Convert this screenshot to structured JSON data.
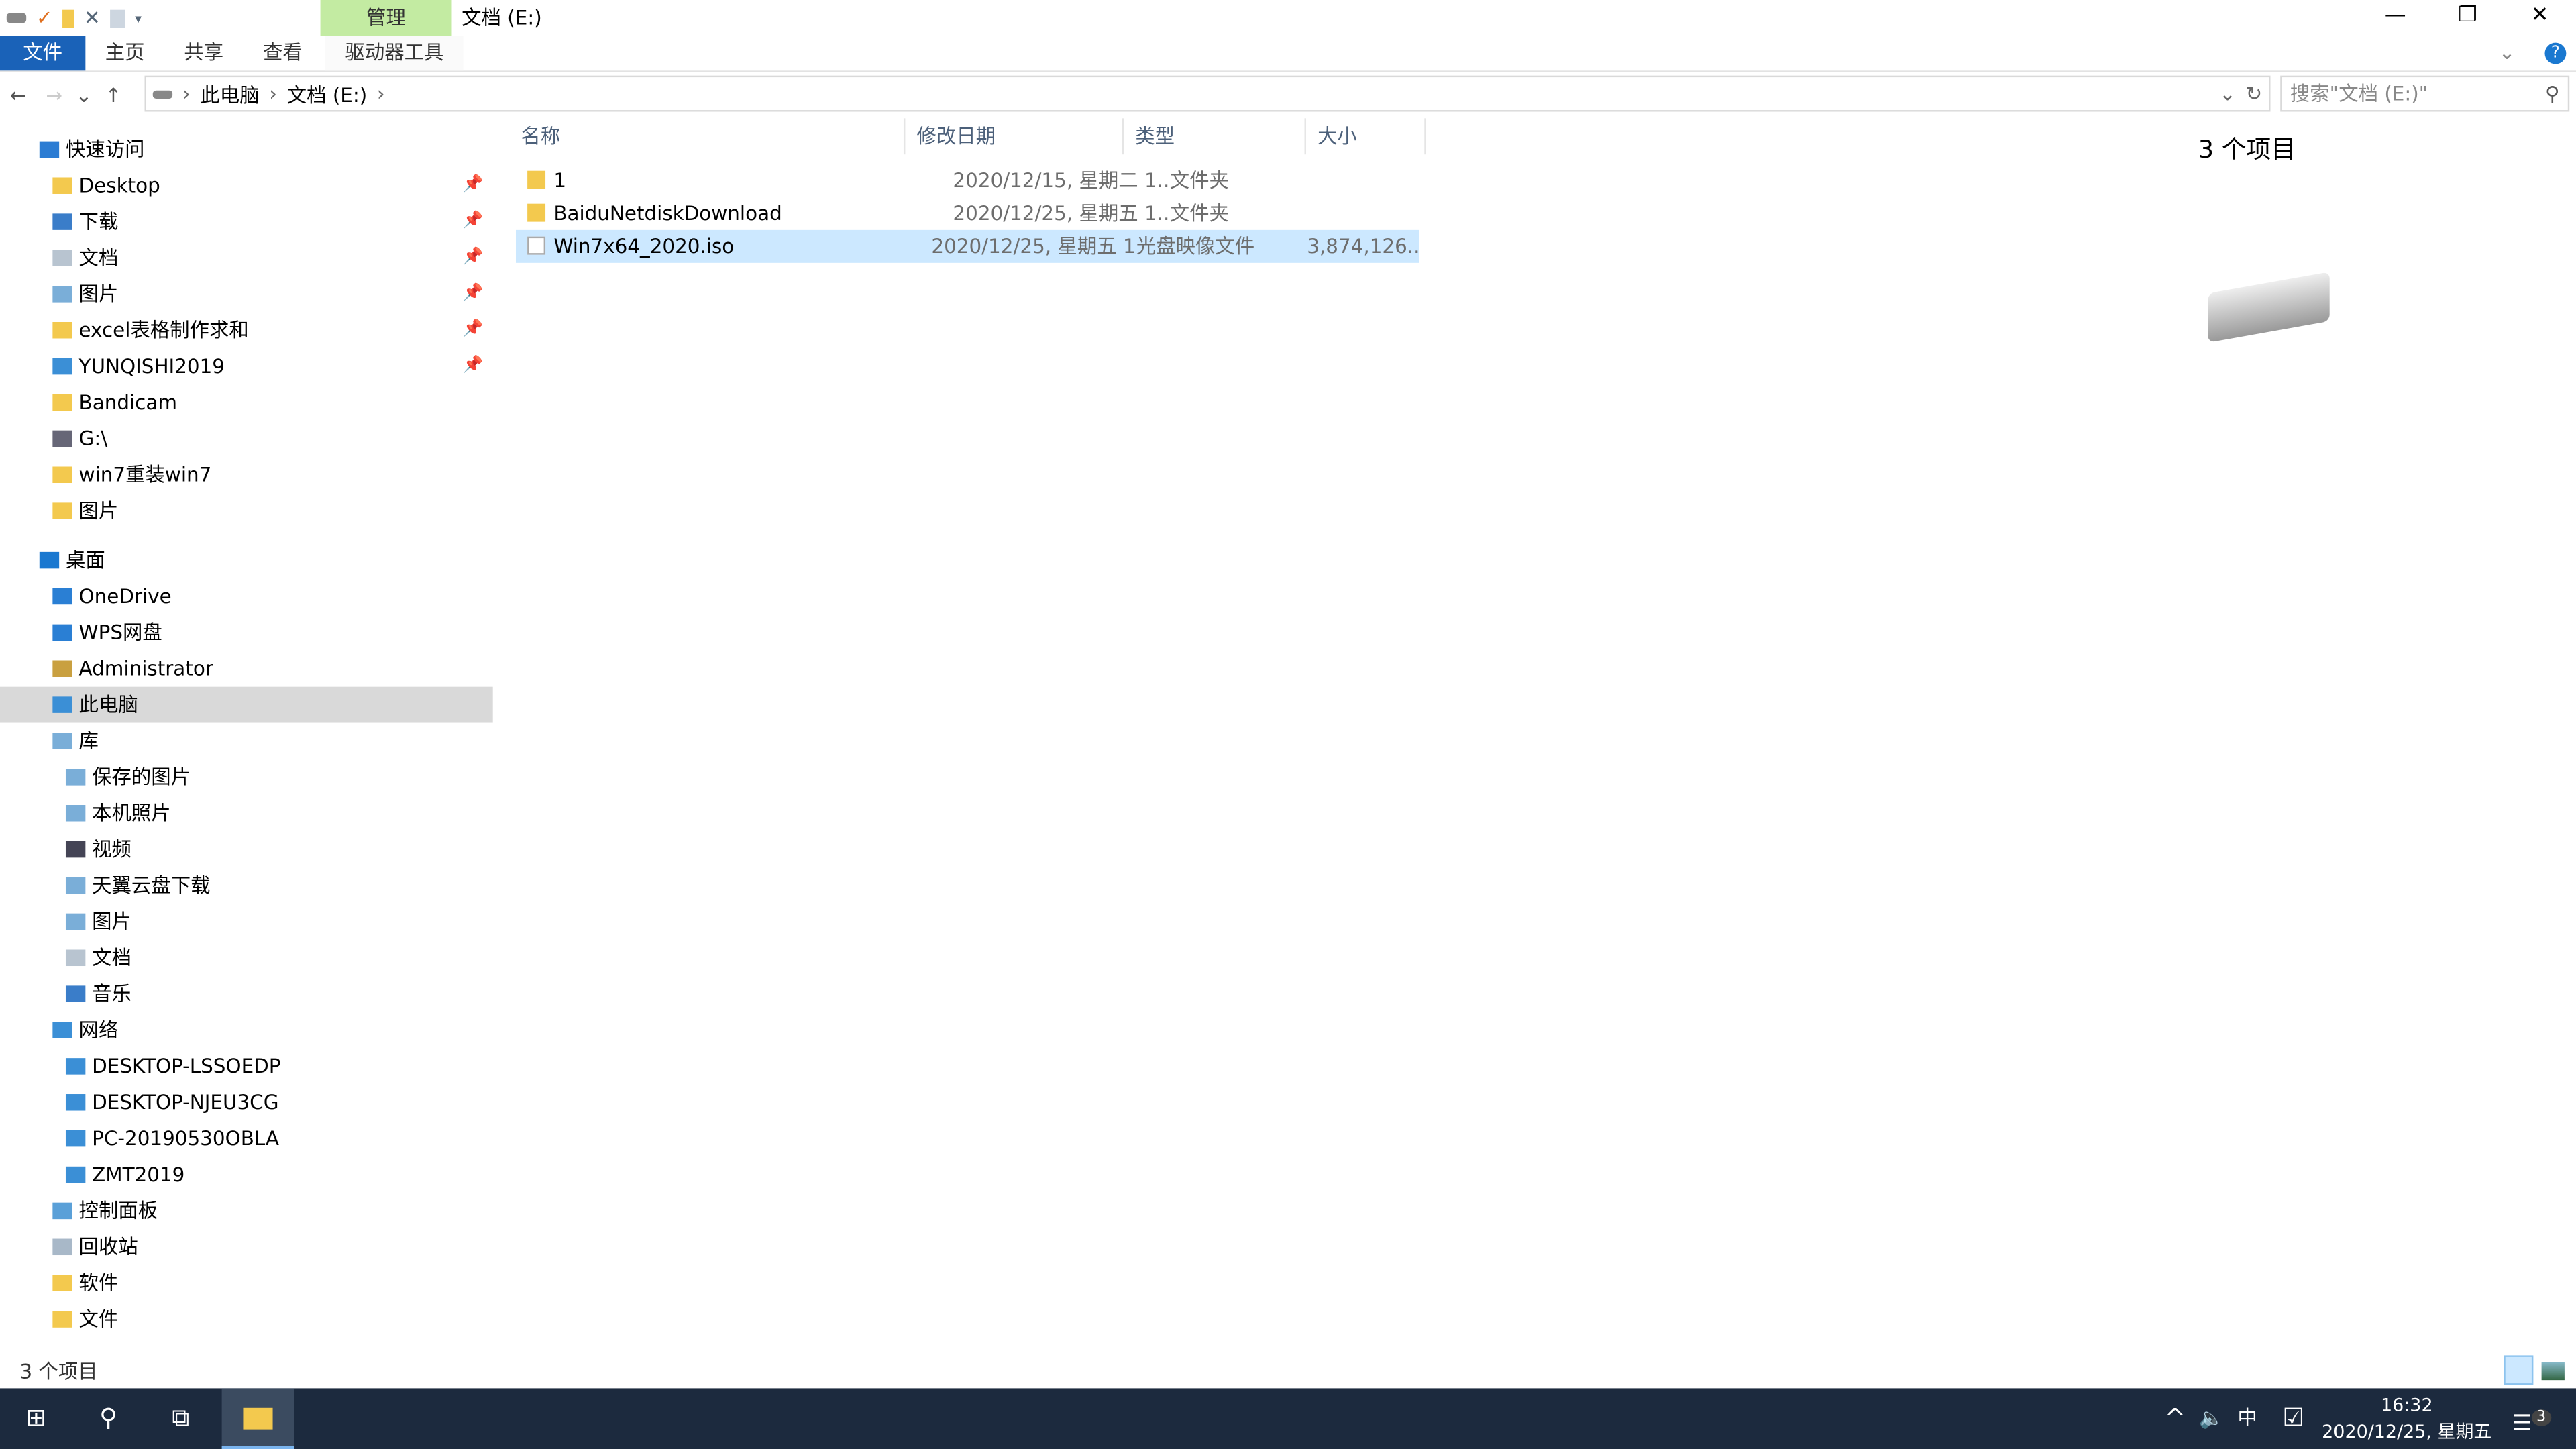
{
  "window": {
    "title": "文档 (E:)",
    "context_tab": "管理",
    "minimize": "—",
    "restore": "❐",
    "close": "✕"
  },
  "ribbon": {
    "tabs": [
      "文件",
      "主页",
      "共享",
      "查看",
      "驱动器工具"
    ]
  },
  "nav": {
    "back": "←",
    "forward": "→",
    "recent": "⌄",
    "up": "↑",
    "breadcrumb": [
      "此电脑",
      "文档 (E:)"
    ],
    "refresh": "↻",
    "dropdown": "⌄",
    "search_placeholder": "搜索\"文档 (E:)\""
  },
  "sidebar": {
    "items": [
      {
        "label": "快速访问",
        "icon": "star-icon",
        "indent": 0
      },
      {
        "label": "Desktop",
        "icon": "folder-icon",
        "indent": 1,
        "pinned": true
      },
      {
        "label": "下载",
        "icon": "download-icon",
        "indent": 1,
        "pinned": true
      },
      {
        "label": "文档",
        "icon": "documents-icon",
        "indent": 1,
        "pinned": true
      },
      {
        "label": "图片",
        "icon": "pictures-icon",
        "indent": 1,
        "pinned": true
      },
      {
        "label": "excel表格制作求和",
        "icon": "folder-icon",
        "indent": 1,
        "pinned": true
      },
      {
        "label": "YUNQISHI2019",
        "icon": "computer-icon",
        "indent": 1,
        "pinned": true
      },
      {
        "label": "Bandicam",
        "icon": "folder-icon",
        "indent": 1
      },
      {
        "label": "G:\\",
        "icon": "network-drive-icon",
        "indent": 1
      },
      {
        "label": "win7重装win7",
        "icon": "folder-icon",
        "indent": 1
      },
      {
        "label": "图片",
        "icon": "folder-icon",
        "indent": 1
      },
      {
        "label": "桌面",
        "icon": "desktop-icon",
        "indent": 0,
        "gap": true
      },
      {
        "label": "OneDrive",
        "icon": "cloud-icon",
        "indent": 1
      },
      {
        "label": "WPS网盘",
        "icon": "cloud-icon",
        "indent": 1
      },
      {
        "label": "Administrator",
        "icon": "user-icon",
        "indent": 1
      },
      {
        "label": "此电脑",
        "icon": "computer-icon",
        "indent": 1,
        "selected": true
      },
      {
        "label": "库",
        "icon": "library-icon",
        "indent": 1
      },
      {
        "label": "保存的图片",
        "icon": "library-icon",
        "indent": 2
      },
      {
        "label": "本机照片",
        "icon": "library-icon",
        "indent": 2
      },
      {
        "label": "视频",
        "icon": "video-icon",
        "indent": 2
      },
      {
        "label": "天翼云盘下载",
        "icon": "library-icon",
        "indent": 2
      },
      {
        "label": "图片",
        "icon": "pictures-icon",
        "indent": 2
      },
      {
        "label": "文档",
        "icon": "documents-icon",
        "indent": 2
      },
      {
        "label": "音乐",
        "icon": "music-icon",
        "indent": 2
      },
      {
        "label": "网络",
        "icon": "network-icon",
        "indent": 1
      },
      {
        "label": "DESKTOP-LSSOEDP",
        "icon": "computer-icon",
        "indent": 2
      },
      {
        "label": "DESKTOP-NJEU3CG",
        "icon": "computer-icon",
        "indent": 2
      },
      {
        "label": "PC-20190530OBLA",
        "icon": "computer-icon",
        "indent": 2
      },
      {
        "label": "ZMT2019",
        "icon": "computer-icon",
        "indent": 2
      },
      {
        "label": "控制面板",
        "icon": "control-panel-icon",
        "indent": 1
      },
      {
        "label": "回收站",
        "icon": "recycle-bin-icon",
        "indent": 1
      },
      {
        "label": "软件",
        "icon": "folder-icon",
        "indent": 1
      },
      {
        "label": "文件",
        "icon": "folder-icon",
        "indent": 1
      }
    ]
  },
  "columns": [
    "名称",
    "修改日期",
    "类型",
    "大小"
  ],
  "files": [
    {
      "name": "1",
      "date": "2020/12/15, 星期二 1...",
      "type": "文件夹",
      "size": "",
      "icon": "folder-icon"
    },
    {
      "name": "BaiduNetdiskDownload",
      "date": "2020/12/25, 星期五 1...",
      "type": "文件夹",
      "size": "",
      "icon": "folder-icon"
    },
    {
      "name": "Win7x64_2020.iso",
      "date": "2020/12/25, 星期五 1...",
      "type": "光盘映像文件",
      "size": "3,874,126...",
      "icon": "iso-file-icon",
      "selected": true
    }
  ],
  "details": {
    "count": "3 个项目"
  },
  "status": {
    "count": "3 个项目"
  },
  "taskbar": {
    "time": "16:32",
    "date": "2020/12/25, 星期五",
    "ime": "中",
    "notifications": "3"
  }
}
